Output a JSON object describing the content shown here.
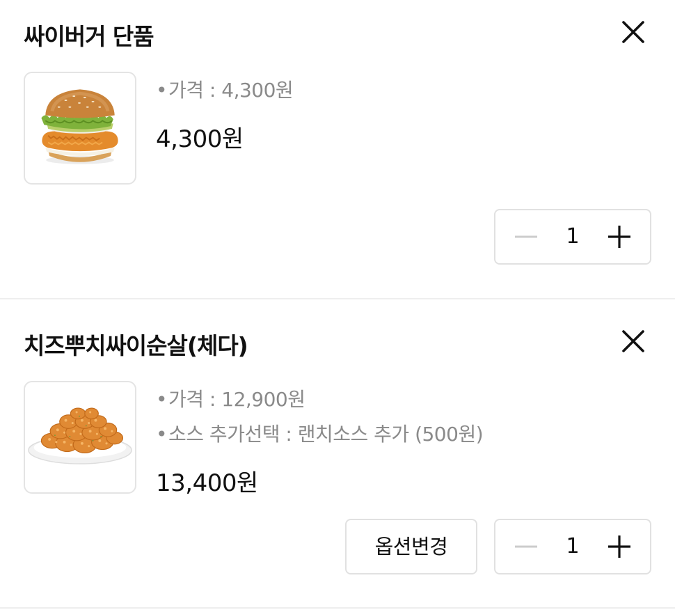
{
  "items": [
    {
      "name": "싸이버거 단품",
      "image_icon": "burger-image",
      "options": [
        {
          "label": "가격",
          "value": "4,300원"
        }
      ],
      "option_lines": [
        "가격 : 4,300원"
      ],
      "total_price": "4,300원",
      "quantity": "1",
      "has_option_change": false
    },
    {
      "name": "치즈뿌치싸이순살(체다)",
      "image_icon": "fried-chicken-image",
      "option_lines": [
        "가격 : 12,900원",
        "소스 추가선택 : 랜치소스 추가 (500원)"
      ],
      "total_price": "13,400원",
      "quantity": "1",
      "has_option_change": true,
      "option_change_label": "옵션변경"
    }
  ],
  "bullet": "•",
  "colors": {
    "text": "#111111",
    "muted": "#8a8a8a",
    "border": "#e1e1e1",
    "divider": "#eeeeee",
    "minus_disabled": "#cccccc"
  }
}
